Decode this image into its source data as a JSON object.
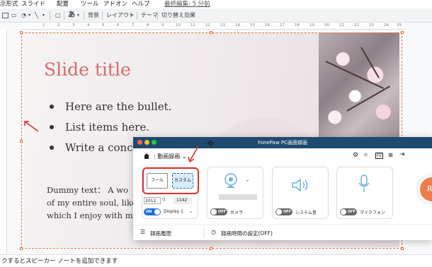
{
  "menubar": {
    "items": [
      "示形式",
      "スライド",
      "配置",
      "ツール",
      "アドオン",
      "ヘルプ"
    ],
    "last_edit": "最終編集: 5 分前"
  },
  "toolbar": {
    "font_button": "あ",
    "background": "背景",
    "layout": "レイアウト",
    "theme": "テーマ",
    "transition": "切り替え効果"
  },
  "ruler": {
    "ticks": [
      "1",
      "2",
      "3",
      "4",
      "5",
      "6",
      "7",
      "8",
      "9",
      "10",
      "11",
      "12",
      "13",
      "14",
      "15",
      "16",
      "17",
      "18",
      "19",
      "20",
      "21",
      "22",
      "23",
      "24",
      "25"
    ]
  },
  "slide": {
    "title": "Slide title",
    "bullets": [
      "Here are the bullet.",
      "List items here.",
      "Write a conce"
    ],
    "dummy_lines": [
      "Dummy text： A wo",
      "of my entire soul, like",
      "which I enjoy with m"
    ]
  },
  "notes": {
    "text": "クするとスピーカー ノートを追加できます"
  },
  "fonepaw": {
    "title": "FonePaw PC画面録画",
    "mode_label": "動画録画",
    "area_full": "フール",
    "area_custom": "カスタム",
    "width_value": "2012",
    "height_value": "1142",
    "display_toggle": "ON",
    "display_select": "Display 1",
    "camera_toggle": "OFF",
    "camera_label": "カメラ",
    "system_toggle": "OFF",
    "system_label": "システム音",
    "mic_toggle": "OFF",
    "mic_label": "マイクフォン",
    "history": "録画履歴",
    "schedule": "録画時間の設定(OFF)",
    "rec_button": "R"
  },
  "colors": {
    "accent_orange": "#e8743b",
    "title_red": "#d96b6b",
    "fonepaw_titlebar": "#1f4a6e",
    "highlight_red": "#e0302a",
    "toggle_blue": "#1e6fd9"
  }
}
